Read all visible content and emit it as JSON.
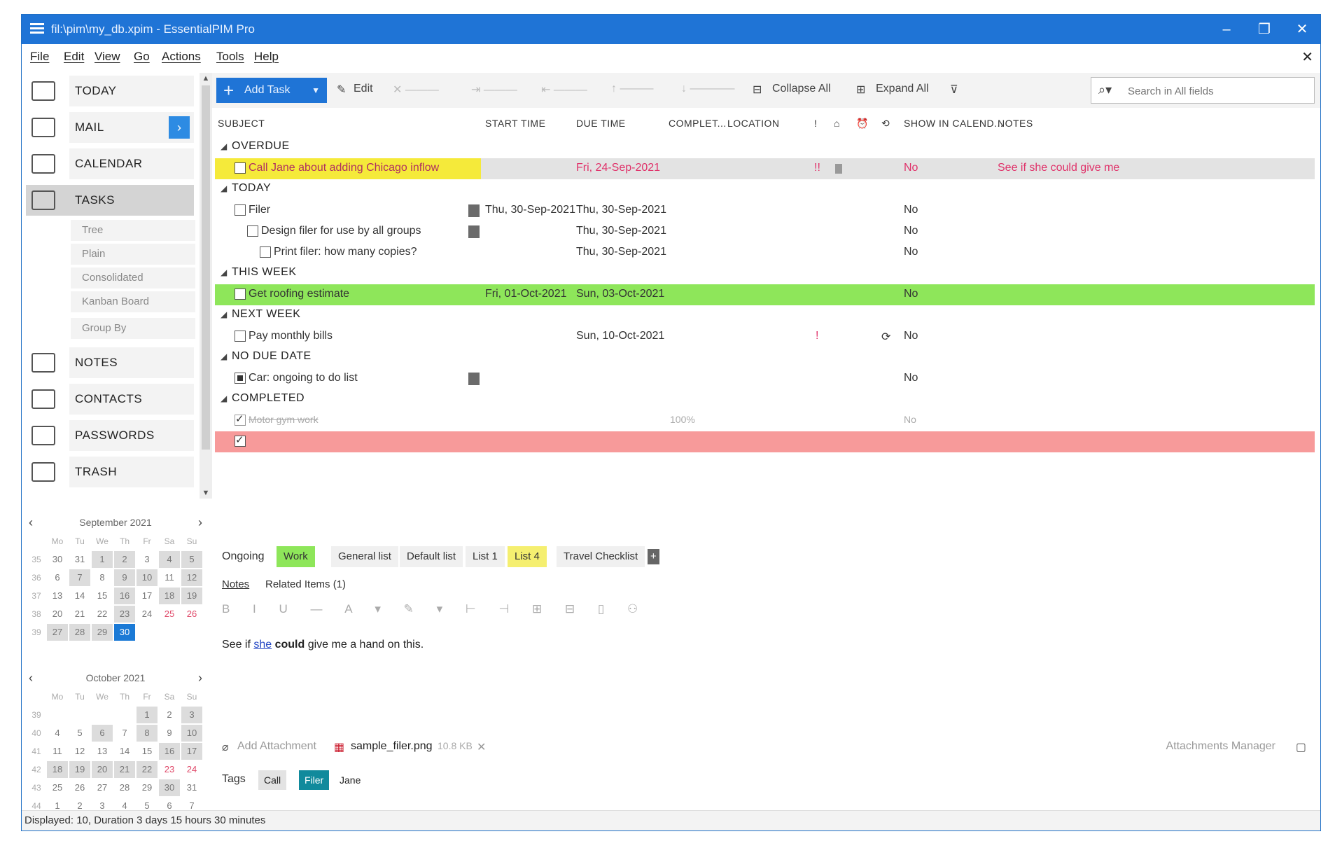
{
  "window": {
    "title": "fil:\\pim\\my_db.xpim - EssentialPIM Pro",
    "controls": [
      "–",
      "❐",
      "✕"
    ]
  },
  "menu": [
    "File",
    "Edit",
    "View",
    "Go",
    "Actions",
    "Tools",
    "Help"
  ],
  "nav": {
    "items": [
      {
        "label": "TODAY",
        "icon": "home-icon"
      },
      {
        "label": "MAIL",
        "icon": "mail-icon"
      },
      {
        "label": "CALENDAR",
        "icon": "calendar-icon"
      },
      {
        "label": "TASKS",
        "icon": "tasks-icon"
      },
      {
        "label": "NOTES",
        "icon": "notes-icon"
      },
      {
        "label": "CONTACTS",
        "icon": "contacts-icon"
      },
      {
        "label": "PASSWORDS",
        "icon": "key-icon"
      },
      {
        "label": "TRASH",
        "icon": "trash-icon"
      }
    ],
    "mail_expand": "›",
    "task_views": [
      "Tree",
      "Plain",
      "Consolidated",
      "Kanban Board",
      "Group By"
    ]
  },
  "calendars": [
    {
      "title": "September 2021",
      "dow": [
        "Mo",
        "Tu",
        "We",
        "Th",
        "Fr",
        "Sa",
        "Su"
      ],
      "weeks": [
        {
          "wk": "35",
          "days": [
            "30",
            "31",
            "1",
            "2",
            "3",
            "4",
            "5"
          ]
        },
        {
          "wk": "36",
          "days": [
            "6",
            "7",
            "8",
            "9",
            "10",
            "11",
            "12"
          ]
        },
        {
          "wk": "37",
          "days": [
            "13",
            "14",
            "15",
            "16",
            "17",
            "18",
            "19"
          ]
        },
        {
          "wk": "38",
          "days": [
            "20",
            "21",
            "22",
            "23",
            "24",
            "25",
            "26"
          ]
        },
        {
          "wk": "39",
          "days": [
            "27",
            "28",
            "29",
            "30",
            "",
            "",
            ""
          ]
        }
      ]
    },
    {
      "title": "October 2021",
      "dow": [
        "Mo",
        "Tu",
        "We",
        "Th",
        "Fr",
        "Sa",
        "Su"
      ],
      "weeks": [
        {
          "wk": "39",
          "days": [
            "",
            "",
            "",
            "",
            "1",
            "2",
            "3"
          ]
        },
        {
          "wk": "40",
          "days": [
            "4",
            "5",
            "6",
            "7",
            "8",
            "9",
            "10"
          ]
        },
        {
          "wk": "41",
          "days": [
            "11",
            "12",
            "13",
            "14",
            "15",
            "16",
            "17"
          ]
        },
        {
          "wk": "42",
          "days": [
            "18",
            "19",
            "20",
            "21",
            "22",
            "23",
            "24"
          ]
        },
        {
          "wk": "43",
          "days": [
            "25",
            "26",
            "27",
            "28",
            "29",
            "30",
            "31"
          ]
        },
        {
          "wk": "44",
          "days": [
            "1",
            "2",
            "3",
            "4",
            "5",
            "6",
            "7"
          ]
        }
      ]
    }
  ],
  "toolbar": {
    "add_task": "Add Task",
    "edit": "Edit",
    "collapse_all": "Collapse All",
    "expand_all": "Expand All",
    "search_placeholder": "Search in All fields"
  },
  "columns": [
    "SUBJECT",
    "START TIME",
    "DUE TIME",
    "COMPLET...",
    "LOCATION",
    "!",
    "SHOW IN CALEND...",
    "NOTES"
  ],
  "groups": {
    "overdue": "OVERDUE",
    "today": "TODAY",
    "this_week": "THIS WEEK",
    "next_week": "NEXT WEEK",
    "no_due_date": "NO DUE DATE",
    "completed": "COMPLETED"
  },
  "tasks": {
    "t1": {
      "subject": "Call Jane about adding Chicago inflow",
      "due": "Fri, 24-Sep-2021",
      "priority": "!!",
      "show": "No",
      "notes": "See if she could give me"
    },
    "t2": {
      "subject": "Filer",
      "start": "Thu, 30-Sep-2021",
      "due": "Thu, 30-Sep-2021",
      "show": "No"
    },
    "t3": {
      "subject": "Design filer for use by all groups",
      "due": "Thu, 30-Sep-2021",
      "show": "No"
    },
    "t4": {
      "subject": "Print filer: how many copies?",
      "due": "Thu, 30-Sep-2021",
      "show": "No"
    },
    "t5": {
      "subject": "Get roofing estimate",
      "start": "Fri, 01-Oct-2021",
      "due": "Sun, 03-Oct-2021",
      "show": "No"
    },
    "t6": {
      "subject": "Pay monthly bills",
      "due": "Sun, 10-Oct-2021",
      "priority": "!",
      "show": "No"
    },
    "t7": {
      "subject": "Car: ongoing to do list",
      "show": "No"
    },
    "t8": {
      "subject": "Motor gym work",
      "complete": "100%",
      "show": "No"
    }
  },
  "bottom_tabs": [
    "Ongoing",
    "Work",
    "General list",
    "Default list",
    "List 1",
    "List 4",
    "Travel Checklist"
  ],
  "notes": {
    "tab_notes": "Notes",
    "tab_related": "Related Items (1)",
    "text_pre": "See if ",
    "text_link": "she",
    "text_bold": "could",
    "text_post": " give me a hand on this.",
    "add_attachment": "Add Attachment",
    "file_name": "sample_filer.png",
    "file_size": "10.8 KB",
    "attachments_manager": "Attachments Manager",
    "tags_label": "Tags",
    "tags": [
      "Call",
      "Filer",
      "Jane"
    ]
  },
  "status": "Displayed: 10, Duration 3 days 15 hours 30 minutes",
  "colors": {
    "accent": "#1f74d6",
    "overdue_row": "#f5ea3a",
    "week_row": "#8ee65a",
    "completed_row": "#f79a9a",
    "overdue_text": "#e0326a"
  }
}
